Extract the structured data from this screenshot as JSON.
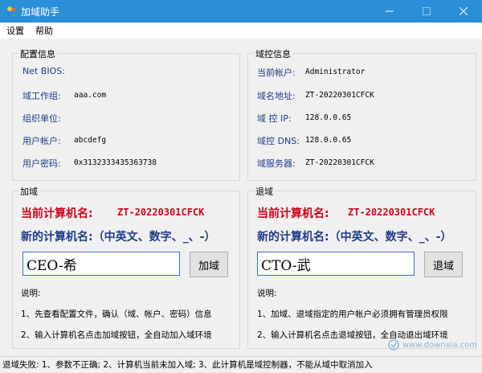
{
  "window": {
    "title": "加域助手"
  },
  "menu": [
    "设置",
    "帮助"
  ],
  "config_group": {
    "title": "配置信息",
    "rows": [
      {
        "label": "Net BIOS:",
        "value": ""
      },
      {
        "label": "域工作组:",
        "value": "aaa.com"
      },
      {
        "label": "组织单位:",
        "value": ""
      },
      {
        "label": "用户帐户:",
        "value": "abcdefg"
      },
      {
        "label": "用户密码:",
        "value": "0x3132333435363738"
      }
    ]
  },
  "domain_group": {
    "title": "域控信息",
    "rows": [
      {
        "label": "当前帐户:",
        "value": "Administrator"
      },
      {
        "label": "域名地址:",
        "value": "ZT-20220301CFCK"
      },
      {
        "label": "域 控 IP:",
        "value": "128.0.0.65"
      },
      {
        "label": "域控 DNS:",
        "value": "128.0.0.65"
      },
      {
        "label": "域服务器:",
        "value": "ZT-20220301CFCK"
      }
    ]
  },
  "join_group": {
    "title": "加域",
    "current_label": "当前计算机名:",
    "current_value": "ZT-20220301CFCK",
    "new_label": "新的计算机名:（中英文、数字、_、-）",
    "input_value": "CEO-希",
    "button": "加域",
    "notes_title": "说明:",
    "notes": [
      "1、先查看配置文件，确认（域、帐户、密码）信息",
      "2、输入计算机名点击加域按钮，全自动加入域环境"
    ]
  },
  "leave_group": {
    "title": "退域",
    "current_label": "当前计算机名:",
    "current_value": "ZT-20220301CFCK",
    "new_label": "新的计算机名:（中英文、数字、_、-）",
    "input_value": "CTO-武",
    "button": "退域",
    "notes_title": "说明:",
    "notes": [
      "1、加域、退域指定的用户帐户必须拥有管理员权限",
      "2、输入计算机名点击退域按钮，全自动退出域环境"
    ]
  },
  "status": "退域失败: 1、参数不正确; 2、计算机当前未加入域; 3、此计算机是域控制器，不能从域中取消加入",
  "watermark": "www.downxia.com",
  "colors": {
    "titlebar": "#2b8fd8",
    "label": "#1f3c88",
    "name": "#d0021b"
  },
  "icons": [
    "users-icon",
    "minimize-icon",
    "maximize-icon",
    "close-icon"
  ]
}
